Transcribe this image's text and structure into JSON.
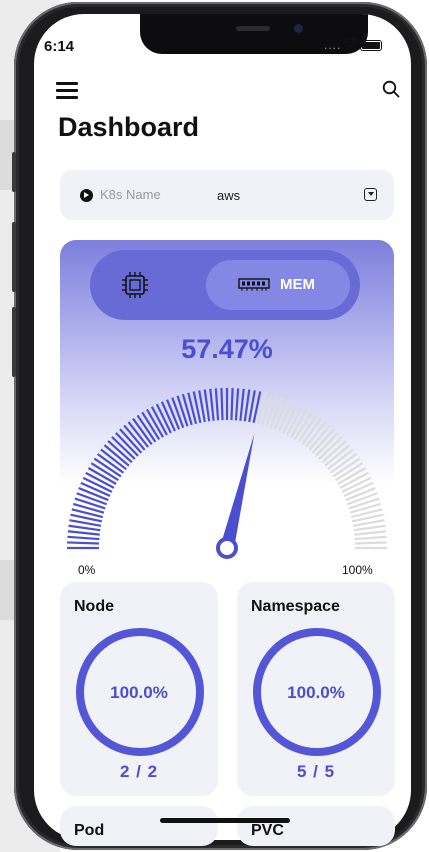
{
  "status_bar": {
    "time": "6:14",
    "signal": "...."
  },
  "header": {
    "title": "Dashboard"
  },
  "selector": {
    "label": "K8s Name",
    "value": "aws"
  },
  "gauge": {
    "options": [
      "CPU",
      "MEM"
    ],
    "selected": "MEM",
    "value_text": "57.47%",
    "value": 57.47,
    "min_label": "0%",
    "max_label": "100%",
    "accent": "#4b4fcf",
    "track": "#dcdcdc"
  },
  "stats": [
    {
      "title": "Node",
      "percent": "100.0%",
      "count": "2 / 2"
    },
    {
      "title": "Namespace",
      "percent": "100.0%",
      "count": "5 / 5"
    }
  ],
  "stats_partial": [
    {
      "title": "Pod"
    },
    {
      "title": "PVC"
    }
  ]
}
